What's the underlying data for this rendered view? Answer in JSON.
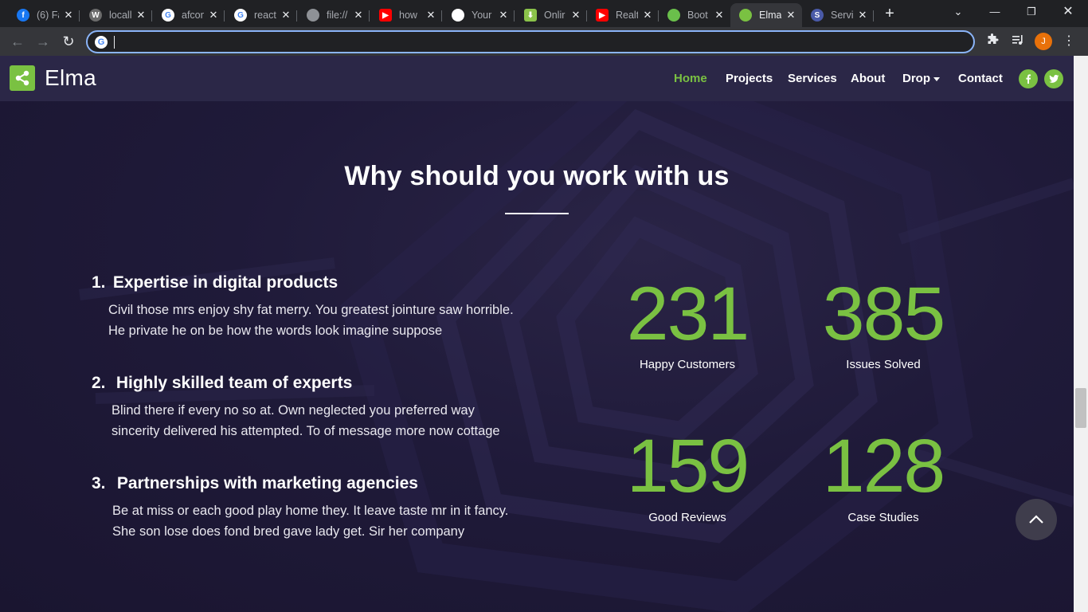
{
  "browser": {
    "tabs": [
      {
        "title": "(6) Fa",
        "icon": "facebook-icon",
        "color": "#1877f2",
        "glyph": "f"
      },
      {
        "title": "locall",
        "icon": "wordpress-icon",
        "color": "#6b6b6b",
        "glyph": "W"
      },
      {
        "title": "afcon",
        "icon": "google-icon",
        "color": "#ffffff",
        "glyph": "G"
      },
      {
        "title": "react",
        "icon": "google-icon",
        "color": "#ffffff",
        "glyph": "G"
      },
      {
        "title": "file://",
        "icon": "globe-icon",
        "color": "#8e9196",
        "glyph": ""
      },
      {
        "title": "how",
        "icon": "youtube-icon",
        "color": "#ff0000",
        "glyph": "▶"
      },
      {
        "title": "Your",
        "icon": "github-icon",
        "color": "#ffffff",
        "glyph": ""
      },
      {
        "title": "Onlir",
        "icon": "download-arrow-icon",
        "color": "#8bc34a",
        "glyph": "⬇"
      },
      {
        "title": "Realt",
        "icon": "youtube-icon",
        "color": "#ff0000",
        "glyph": "▶"
      },
      {
        "title": "Boot",
        "icon": "leaf-icon",
        "color": "#6abf4b",
        "glyph": ""
      },
      {
        "title": "Elma",
        "icon": "share-icon",
        "color": "#7ac142",
        "glyph": "",
        "active": true
      },
      {
        "title": "Servi",
        "icon": "s-letter-icon",
        "color": "#4a5aa8",
        "glyph": "S"
      }
    ],
    "address_value": "",
    "profile_initial": "J"
  },
  "site": {
    "brand": "Elma",
    "nav": [
      "Home",
      "Projects",
      "Services",
      "About",
      "Drop",
      "Contact"
    ],
    "active_nav": "Home",
    "accent": "#7ac142"
  },
  "section": {
    "title": "Why should you work with us",
    "features": [
      {
        "number": "1.",
        "title": "Expertise in digital products",
        "lines": [
          "Civil those mrs enjoy shy fat merry. You greatest jointure saw horrible.",
          "He private he on be how the words look imagine suppose"
        ]
      },
      {
        "number": "2.",
        "title": "Highly skilled team of experts",
        "lines": [
          "Blind there if every no so at. Own neglected you preferred way",
          "sincerity delivered his attempted. To of message more now cottage"
        ]
      },
      {
        "number": "3.",
        "title": "Partnerships with marketing agencies",
        "lines": [
          "Be at miss or each good play home they. It leave taste mr in it fancy.",
          "She son lose does fond bred gave lady get. Sir her company"
        ]
      }
    ],
    "stats": [
      {
        "value": "231",
        "label": "Happy Customers"
      },
      {
        "value": "385",
        "label": "Issues Solved"
      },
      {
        "value": "159",
        "label": "Good Reviews"
      },
      {
        "value": "128",
        "label": "Case Studies"
      }
    ]
  }
}
